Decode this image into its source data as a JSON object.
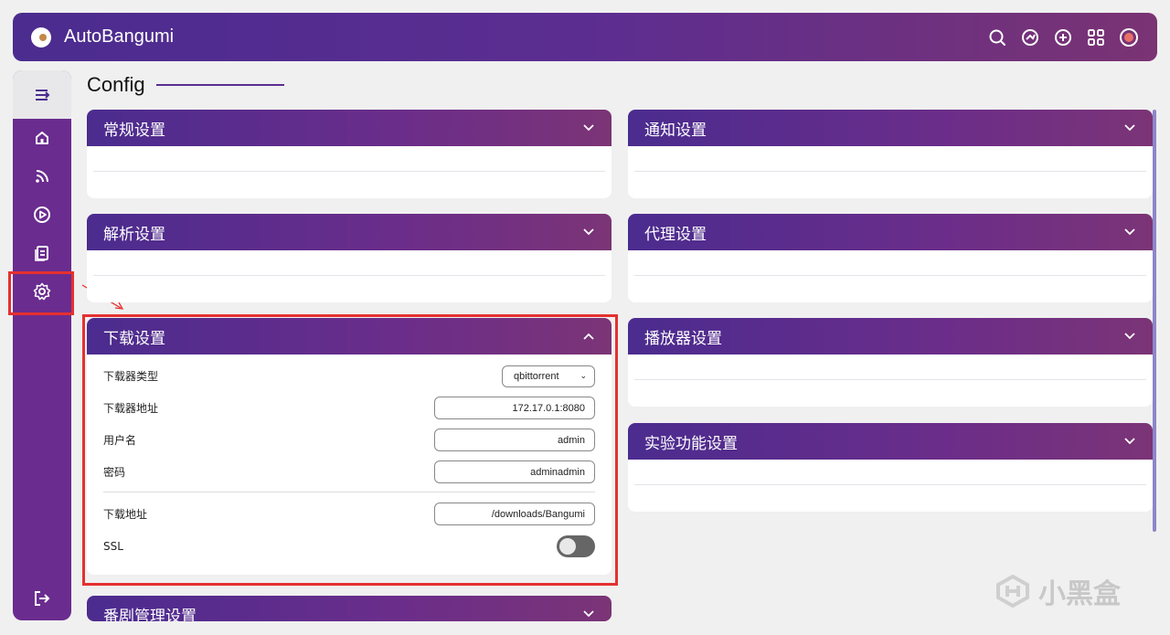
{
  "app": {
    "title": "AutoBangumi"
  },
  "page": {
    "title": "Config"
  },
  "panels": {
    "general": {
      "title": "常规设置"
    },
    "notify": {
      "title": "通知设置"
    },
    "parser": {
      "title": "解析设置"
    },
    "proxy": {
      "title": "代理设置"
    },
    "download": {
      "title": "下载设置",
      "fields": {
        "type": {
          "label": "下载器类型",
          "value": "qbittorrent"
        },
        "host": {
          "label": "下载器地址",
          "value": "172.17.0.1:8080"
        },
        "username": {
          "label": "用户名",
          "value": "admin"
        },
        "password": {
          "label": "密码",
          "value": "adminadmin"
        },
        "path": {
          "label": "下载地址",
          "value": "/downloads/Bangumi"
        },
        "ssl": {
          "label": "SSL",
          "enabled": false
        }
      }
    },
    "player": {
      "title": "播放器设置"
    },
    "experimental": {
      "title": "实验功能设置"
    },
    "manage": {
      "title": "番剧管理设置"
    }
  },
  "watermark": {
    "text": "小黑盒"
  },
  "colors": {
    "accent": "#5c2d91",
    "sidebar": "#6a2c8f",
    "highlight": "#e53030"
  }
}
